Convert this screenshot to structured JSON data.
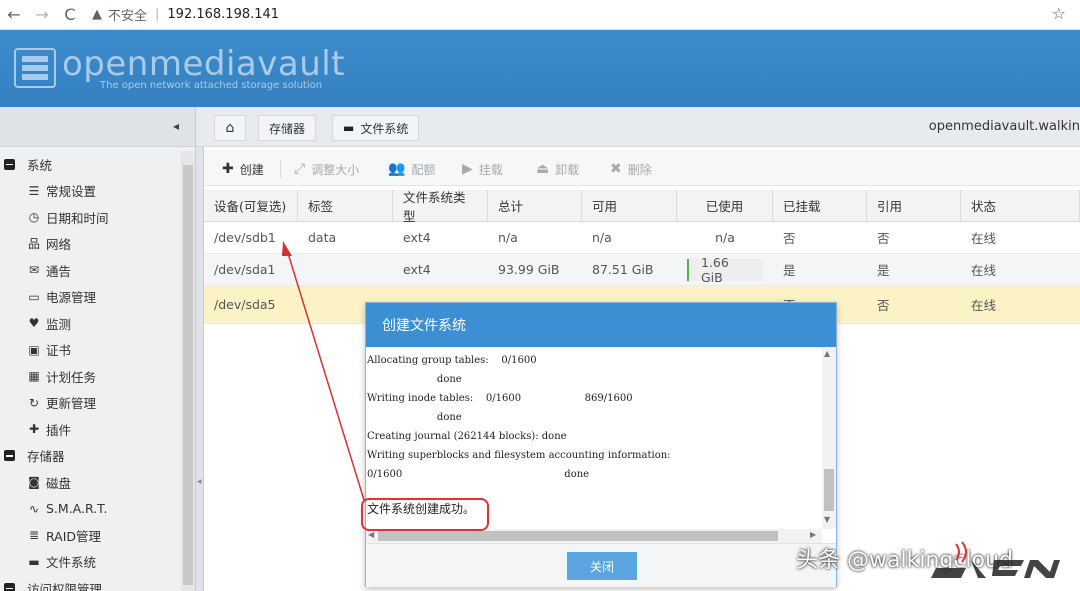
{
  "browser": {
    "back_glyph": "←",
    "forward_glyph": "→",
    "reload_glyph": "C",
    "warn_glyph": "▲",
    "security_label": "不安全",
    "separator": "|",
    "url": "192.168.198.141",
    "star_glyph": "☆"
  },
  "header": {
    "app_name": "openmediavault",
    "tagline": "The open network attached storage solution"
  },
  "sidebar": {
    "collapse_glyph": "◂",
    "items": [
      {
        "type": "group",
        "label": "系统",
        "icon": "minus-box-icon"
      },
      {
        "type": "item",
        "label": "常规设置",
        "icon": "sliders-icon",
        "glyph": "☰"
      },
      {
        "type": "item",
        "label": "日期和时间",
        "icon": "clock-icon",
        "glyph": "◷"
      },
      {
        "type": "item",
        "label": "网络",
        "icon": "network-icon",
        "glyph": "品"
      },
      {
        "type": "item",
        "label": "通告",
        "icon": "mail-icon",
        "glyph": "✉"
      },
      {
        "type": "item",
        "label": "电源管理",
        "icon": "battery-icon",
        "glyph": "▭"
      },
      {
        "type": "item",
        "label": "监测",
        "icon": "heartbeat-icon",
        "glyph": "♥"
      },
      {
        "type": "item",
        "label": "证书",
        "icon": "certificate-icon",
        "glyph": "▣"
      },
      {
        "type": "item",
        "label": "计划任务",
        "icon": "calendar-icon",
        "glyph": "▦"
      },
      {
        "type": "item",
        "label": "更新管理",
        "icon": "refresh-icon",
        "glyph": "↻"
      },
      {
        "type": "item",
        "label": "插件",
        "icon": "puzzle-icon",
        "glyph": "✚"
      },
      {
        "type": "group",
        "label": "存储器",
        "icon": "minus-box-icon"
      },
      {
        "type": "item",
        "label": "磁盘",
        "icon": "disk-icon",
        "glyph": "◙"
      },
      {
        "type": "item",
        "label": "S.M.A.R.T.",
        "icon": "pulse-icon",
        "glyph": "∿"
      },
      {
        "type": "item",
        "label": "RAID管理",
        "icon": "database-icon",
        "glyph": "≣"
      },
      {
        "type": "item",
        "label": "文件系统",
        "icon": "folder-icon",
        "glyph": "▬"
      },
      {
        "type": "group",
        "label": "访问权限管理",
        "icon": "minus-box-icon"
      }
    ]
  },
  "breadcrumb": {
    "home_glyph": "⌂",
    "storage": "存储器",
    "filesystem_glyph": "▬",
    "filesystem": "文件系统",
    "host": "openmediavault.walkin"
  },
  "toolbar": {
    "create": {
      "label": "创建",
      "glyph": "✚"
    },
    "resize": {
      "label": "调整大小",
      "glyph": "⤢"
    },
    "quota": {
      "label": "配额",
      "glyph": "👥"
    },
    "mount": {
      "label": "挂载",
      "glyph": "▶"
    },
    "unmount": {
      "label": "卸载",
      "glyph": "⏏"
    },
    "delete": {
      "label": "删除",
      "glyph": "✖"
    }
  },
  "grid": {
    "columns": [
      "设备(可复选)",
      "标签",
      "文件系统类型",
      "总计",
      "可用",
      "已使用",
      "已挂载",
      "引用",
      "状态"
    ],
    "rows": [
      {
        "device": "/dev/sdb1",
        "label": "data",
        "fstype": "ext4",
        "total": "n/a",
        "available": "n/a",
        "used": "n/a",
        "mounted": "否",
        "referenced": "否",
        "status": "在线"
      },
      {
        "device": "/dev/sda1",
        "label": "",
        "fstype": "ext4",
        "total": "93.99 GiB",
        "available": "87.51 GiB",
        "used": "1.66 GiB",
        "mounted": "是",
        "referenced": "是",
        "status": "在线"
      },
      {
        "device": "/dev/sda5",
        "label": "",
        "fstype": "",
        "total": "",
        "available": "",
        "used": "",
        "mounted": "否",
        "referenced": "否",
        "status": "在线"
      }
    ]
  },
  "modal": {
    "title": "创建文件系统",
    "log_lines": [
      "Allocating group tables:    0/1600",
      "                      done",
      "Writing inode tables:    0/1600                    869/1600",
      "                      done",
      "Creating journal (262144 blocks): done",
      "Writing superblocks and filesystem accounting information:",
      "0/1600                                                   done"
    ],
    "success_message": "文件系统创建成功。",
    "close_label": "关闭",
    "scroll_up_glyph": "▲",
    "scroll_down_glyph": "▼",
    "scroll_left_glyph": "◀",
    "scroll_right_glyph": "▶"
  },
  "watermark": {
    "text": "头条 @walkingcloud"
  },
  "colors": {
    "header_blue": "#3a86c8",
    "modal_title_blue": "#3c8fd2",
    "button_blue": "#5ba4e0",
    "annotation_red": "#d33333",
    "selected_row": "#fbf3c6"
  }
}
